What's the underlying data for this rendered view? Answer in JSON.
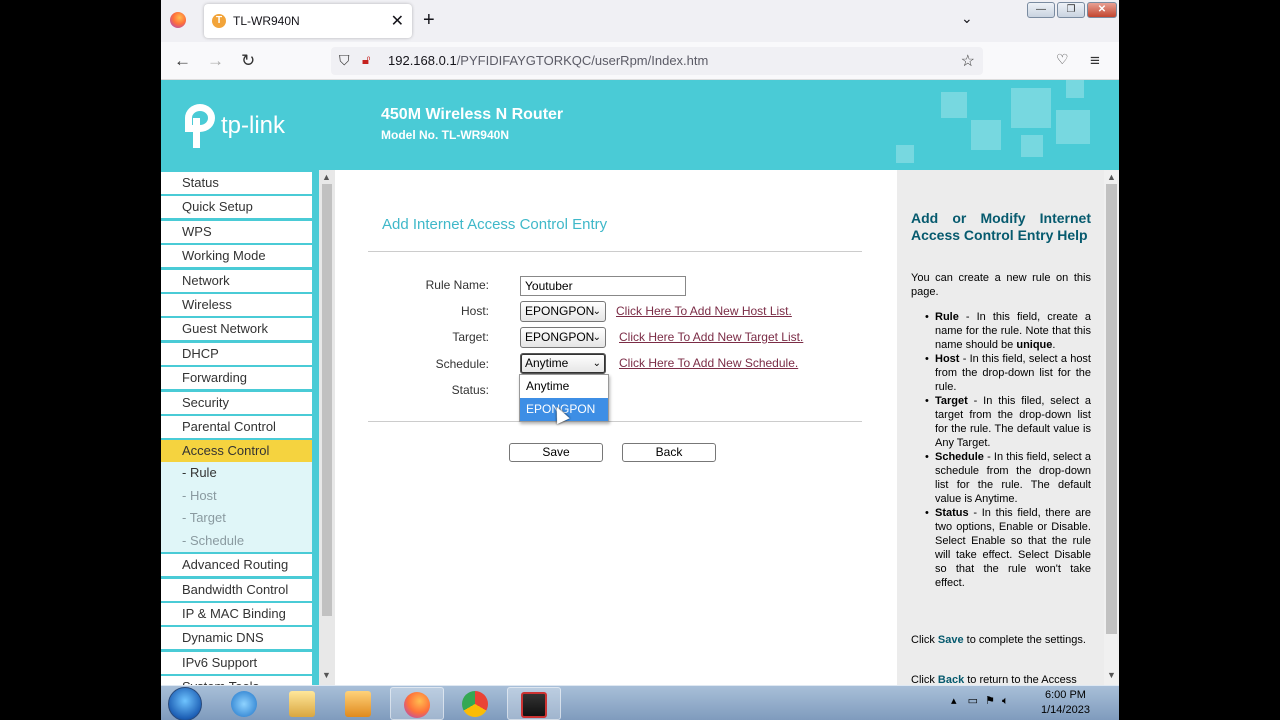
{
  "browser": {
    "tab_title": "TL-WR940N",
    "url_host": "192.168.0.1",
    "url_path": "/PYFIDIFAYGTORKQC/userRpm/Index.htm"
  },
  "router": {
    "brand": "tp-link",
    "title": "450M Wireless N Router",
    "model": "Model No. TL-WR940N"
  },
  "menu": [
    "Status",
    "Quick Setup",
    "WPS",
    "Working Mode",
    "Network",
    "Wireless",
    "Guest Network",
    "DHCP",
    "Forwarding",
    "Security",
    "Parental Control",
    "Access Control"
  ],
  "submenu": [
    "- Rule",
    "- Host",
    "- Target",
    "- Schedule"
  ],
  "menu_after": [
    "Advanced Routing",
    "Bandwidth Control",
    "IP & MAC Binding",
    "Dynamic DNS",
    "IPv6 Support",
    "System Tools"
  ],
  "form": {
    "title": "Add Internet Access Control Entry",
    "rule_label": "Rule Name:",
    "rule_value": "Youtuber",
    "host_label": "Host:",
    "host_value": "EPONGPON",
    "host_link": "Click Here To Add New Host List.",
    "target_label": "Target:",
    "target_value": "EPONGPON",
    "target_link": "Click Here To Add New Target List.",
    "schedule_label": "Schedule:",
    "schedule_value": "Anytime",
    "schedule_link": "Click Here To Add New Schedule.",
    "status_label": "Status:",
    "schedule_options": [
      "Anytime",
      "EPONGPON"
    ],
    "save": "Save",
    "back": "Back"
  },
  "help": {
    "title": "Add or Modify Internet Access Control Entry Help",
    "intro": "You can create a new rule on this page.",
    "items": [
      {
        "term": "Rule",
        "text": " - In this field, create a name for the rule. Note that this name should be ",
        "em": "unique",
        "end": "."
      },
      {
        "term": "Host",
        "text": " - In this field, select a host from the drop-down list for the rule."
      },
      {
        "term": "Target",
        "text": " - In this filed, select a target from the drop-down list for the rule. The default value is Any Target."
      },
      {
        "term": "Schedule",
        "text": " - In this field, select a schedule from the drop-down list for the rule. The default value is Anytime."
      },
      {
        "term": "Status",
        "text": " - In this field, there are two options, Enable or Disable. Select Enable so that the rule will take effect. Select Disable so that the rule won't take effect."
      }
    ],
    "click_save_1": "Click ",
    "click_save_2": "Save",
    "click_save_3": " to complete the settings.",
    "click_back_1": "Click ",
    "click_back_2": "Back",
    "click_back_3": " to return to the Access"
  },
  "taskbar": {
    "time": "6:00 PM",
    "date": "1/14/2023"
  },
  "colors": {
    "brand_teal": "#4acbd6",
    "active_menu": "#f5d33f",
    "link": "#7b2c46"
  }
}
